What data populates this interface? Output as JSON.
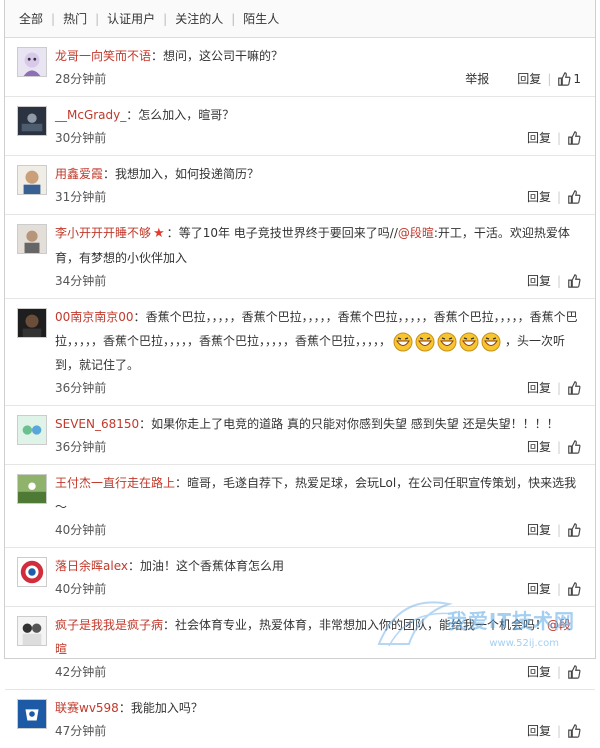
{
  "filters": [
    "全部",
    "热门",
    "认证用户",
    "关注的人",
    "陌生人"
  ],
  "report_label": "举报",
  "reply_label": "回复",
  "watermark": {
    "main": "我爱IT技术网",
    "sub": "www.52ij.com"
  },
  "comments": [
    {
      "user": "龙哥一向笑而不语",
      "sep": "：",
      "text": "想问，这公司干嘛的？",
      "time": "28分钟前",
      "likes": "1"
    },
    {
      "user": "__McGrady_",
      "sep": "：",
      "text": "怎么加入，暄哥？",
      "time": "30分钟前"
    },
    {
      "user": "用鑫爱霞",
      "sep": "：",
      "text": "我想加入，如何投递简历？",
      "time": "31分钟前"
    },
    {
      "user": "李小开开开睡不够",
      "sep": "：",
      "text": "等了10年 电子竞技世界终于要回来了吗//",
      "mention": "@段暄",
      "text2": ":开工，干活。欢迎热爱体育，有梦想的小伙伴加入",
      "time": "34分钟前"
    },
    {
      "user": "00南京南京00",
      "sep": "：",
      "text": "香蕉个巴拉，，，，，香蕉个巴拉，，，，，香蕉个巴拉，，，，，香蕉个巴拉，，，，，香蕉个巴拉，，，，，香蕉个巴拉，，，，，香蕉个巴拉，，，，，香蕉个巴拉，，，，，",
      "text2": "，头一次听到，就记住了。",
      "time": "36分钟前"
    },
    {
      "user": "SEVEN_68150",
      "sep": "：",
      "text": "如果你走上了电竞的道路 真的只能对你感到失望 感到失望 还是失望！！！！",
      "time": "36分钟前"
    },
    {
      "user": "王付杰一直行走在路上",
      "sep": "：",
      "text": "暄哥，毛遂自荐下，热爱足球，会玩Lol，在公司任职宣传策划，快来选我～",
      "time": "40分钟前"
    },
    {
      "user": "落日余晖alex",
      "sep": "：",
      "text": "加油！这个香蕉体育怎么用",
      "time": "40分钟前"
    },
    {
      "user": "疯子是我我是疯子病",
      "sep": "：",
      "text": "社会体育专业，热爱体育，非常想加入你的团队，能给我一个机会吗！",
      "mention": "@段暄",
      "time": "42分钟前"
    },
    {
      "user": "联赛wv598",
      "sep": "：",
      "text": "我能加入吗？",
      "time": "47分钟前"
    }
  ]
}
